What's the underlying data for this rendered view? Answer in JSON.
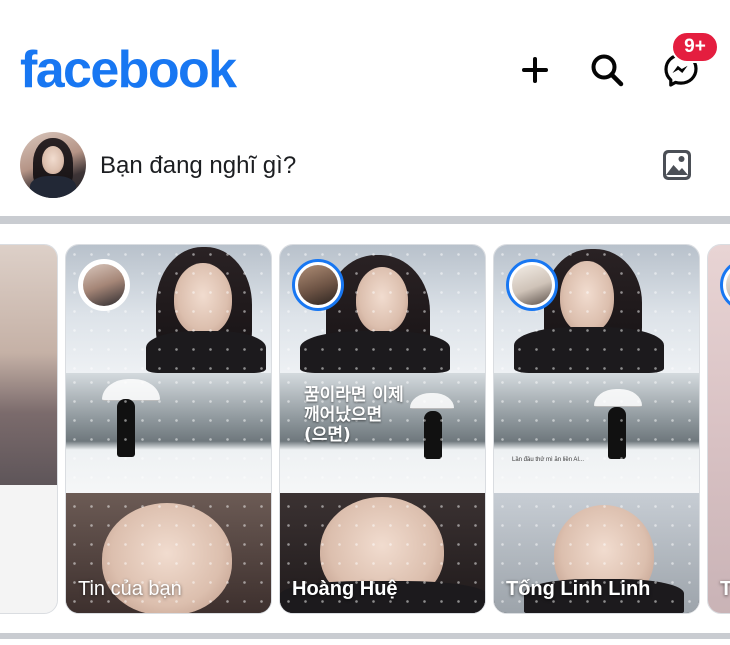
{
  "app": {
    "logo_text": "facebook",
    "brand_color": "#1877f2"
  },
  "header": {
    "actions": [
      {
        "name": "create",
        "icon": "plus-icon"
      },
      {
        "name": "search",
        "icon": "search-icon"
      },
      {
        "name": "messenger",
        "icon": "messenger-icon",
        "badge": "9+"
      }
    ],
    "badge_color": "#e41e3f"
  },
  "composer": {
    "placeholder": "Bạn đang nghĩ gì?",
    "photo_icon": "photo-icon"
  },
  "stories": [
    {
      "name": ""
    },
    {
      "name": "Tin của bạn",
      "is_own": true
    },
    {
      "name": "Hoàng Huệ",
      "overlay_text": "꿈이라면 이제\n깨어났으면\n(으면)"
    },
    {
      "name": "Tống Linh Linh",
      "caption": "Lần đầu thử mì ăn liền AI..."
    },
    {
      "name": "T"
    }
  ]
}
